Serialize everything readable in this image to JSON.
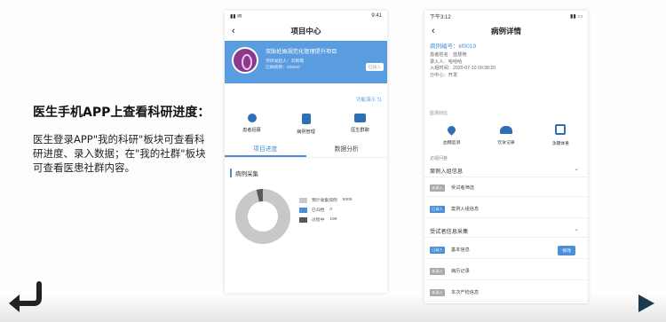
{
  "slide": {
    "headline": "医生手机APP上查看科研进度：",
    "description": "医生登录APP\"我的科研\"板块可查看科研进度、录入数据；在\"我的社群\"板块可查看医患社群内容。"
  },
  "phone1": {
    "status_time": "9:41",
    "title": "项目中心",
    "back_icon": "chevron-left-icon",
    "project": {
      "name": "双胎妊娠规范化管理提升项目",
      "initiator_label": "项目发起人：",
      "initiator": "刘新霞",
      "cases_label": "已纳病例：",
      "cases": "0/5000",
      "status_badge": "已加入"
    },
    "demo_link": "功能演示",
    "menu": [
      {
        "label": "患者招募",
        "icon": "patient-recruit-icon"
      },
      {
        "label": "病例管理",
        "icon": "case-management-icon"
      },
      {
        "label": "医生群聊",
        "icon": "group-chat-icon"
      }
    ],
    "tabs": [
      "项目进度",
      "数据分析"
    ],
    "section_title": "病例采集",
    "chart_data": {
      "type": "pie",
      "categories": [
        "预计收集病例",
        "已归档",
        "过程中"
      ],
      "values": [
        5000,
        0,
        199
      ],
      "colors": [
        "#c8c8c8",
        "#4a8fd8",
        "#555a60"
      ]
    }
  },
  "phone2": {
    "status_time": "下午3:12",
    "title": "病例详情",
    "case_code_label": "病例编号：",
    "case_code": "kf0019",
    "info": [
      {
        "label": "患者姓名：",
        "value": "蓝慧艳"
      },
      {
        "label": "录入人：",
        "value": "哈哈哈"
      },
      {
        "label": "入组时间：",
        "value": "2020-07-10 09:38:20"
      },
      {
        "label": "分中心：",
        "value": "开发"
      }
    ],
    "monitor_label": "监测对比",
    "monitor_items": [
      {
        "label": "血糖监测",
        "icon": "blood-drop-icon"
      },
      {
        "label": "饮食记录",
        "icon": "food-cloche-icon"
      },
      {
        "label": "孕期体重",
        "icon": "scale-icon"
      }
    ],
    "followup_label": "访视问卷",
    "group1": {
      "title": "案例入组信息",
      "items": [
        {
          "tag": "未录入",
          "tag_color": "gray",
          "name": "受试者筛选"
        },
        {
          "tag": "已录入",
          "tag_color": "blue",
          "name": "案例入组信息"
        }
      ]
    },
    "group2": {
      "title": "受试者信息采集",
      "items": [
        {
          "tag": "已录入",
          "tag_color": "blue",
          "name": "基本信息",
          "action": "修改"
        },
        {
          "tag": "未录入",
          "tag_color": "gray",
          "name": "病历记录"
        },
        {
          "tag": "未录入",
          "tag_color": "gray",
          "name": "本次产检信息"
        }
      ]
    }
  }
}
